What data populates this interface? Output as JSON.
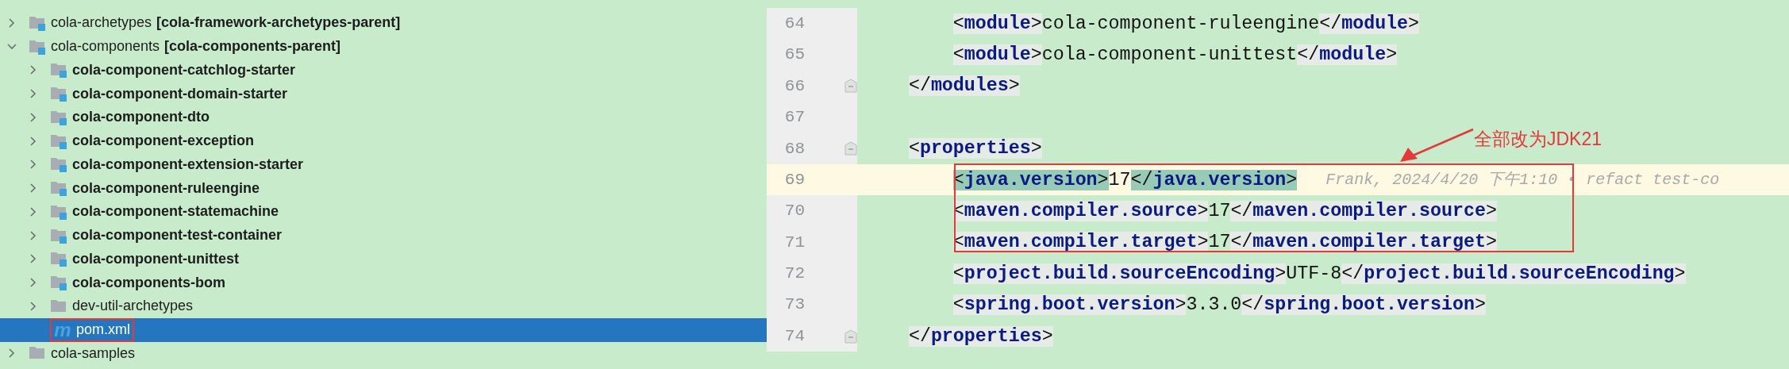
{
  "tree": [
    {
      "name": "cola-archetypes",
      "module": "[cola-framework-archetypes-parent]",
      "kind": "module",
      "bold": false,
      "expanded": false,
      "selected": false,
      "boxed": false
    },
    {
      "name": "cola-components",
      "module": "[cola-components-parent]",
      "kind": "module",
      "bold": false,
      "expanded": true,
      "selected": false,
      "boxed": false,
      "children": [
        {
          "name": "cola-component-catchlog-starter",
          "kind": "module",
          "bold": true,
          "expanded": false,
          "selected": false,
          "boxed": false
        },
        {
          "name": "cola-component-domain-starter",
          "kind": "module",
          "bold": true,
          "expanded": false,
          "selected": false,
          "boxed": false
        },
        {
          "name": "cola-component-dto",
          "kind": "module",
          "bold": true,
          "expanded": false,
          "selected": false,
          "boxed": false
        },
        {
          "name": "cola-component-exception",
          "kind": "module",
          "bold": true,
          "expanded": false,
          "selected": false,
          "boxed": false
        },
        {
          "name": "cola-component-extension-starter",
          "kind": "module",
          "bold": true,
          "expanded": false,
          "selected": false,
          "boxed": false
        },
        {
          "name": "cola-component-ruleengine",
          "kind": "module",
          "bold": true,
          "expanded": false,
          "selected": false,
          "boxed": false
        },
        {
          "name": "cola-component-statemachine",
          "kind": "module",
          "bold": true,
          "expanded": false,
          "selected": false,
          "boxed": false
        },
        {
          "name": "cola-component-test-container",
          "kind": "module",
          "bold": true,
          "expanded": false,
          "selected": false,
          "boxed": false
        },
        {
          "name": "cola-component-unittest",
          "kind": "module",
          "bold": true,
          "expanded": false,
          "selected": false,
          "boxed": false
        },
        {
          "name": "cola-components-bom",
          "kind": "module",
          "bold": true,
          "expanded": false,
          "selected": false,
          "boxed": false
        },
        {
          "name": "dev-util-archetypes",
          "kind": "folder",
          "bold": false,
          "expanded": false,
          "selected": false,
          "boxed": false
        },
        {
          "name": "pom.xml",
          "kind": "maven-file",
          "icon": "m",
          "bold": false,
          "selected": true,
          "boxed": true
        }
      ]
    },
    {
      "name": "cola-samples",
      "kind": "folder",
      "bold": false,
      "expanded": false,
      "selected": false,
      "boxed": false
    }
  ],
  "editor": {
    "lines": [
      {
        "number": "64",
        "current": false,
        "fold": false,
        "tokens": [
          {
            "kind": "tag",
            "text": "        <module>",
            "matched": false
          },
          {
            "kind": "text",
            "text": "cola-component-ruleengine"
          },
          {
            "kind": "tag",
            "text": "</module>",
            "matched": false
          }
        ]
      },
      {
        "number": "65",
        "current": false,
        "fold": false,
        "tokens": [
          {
            "kind": "tag",
            "text": "        <module>",
            "matched": false
          },
          {
            "kind": "text",
            "text": "cola-component-unittest"
          },
          {
            "kind": "tag",
            "text": "</module>",
            "matched": false
          }
        ]
      },
      {
        "number": "66",
        "current": false,
        "fold": true,
        "tokens": [
          {
            "kind": "tag",
            "text": "    </modules>",
            "matched": false
          }
        ]
      },
      {
        "number": "67",
        "current": false,
        "fold": false
      },
      {
        "number": "68",
        "current": false,
        "fold": true,
        "tokens": [
          {
            "kind": "tag",
            "text": "    <properties>",
            "matched": false
          }
        ]
      },
      {
        "number": "69",
        "current": true,
        "fold": false,
        "blame": "Frank, 2024/4/20 下午1:10 • refact test-co",
        "tokens": [
          {
            "kind": "tag",
            "text": "        <java.version>",
            "matched": true
          },
          {
            "kind": "text",
            "text": "17"
          },
          {
            "kind": "tag",
            "text": "</java.version>",
            "matched": true
          }
        ]
      },
      {
        "number": "70",
        "current": false,
        "fold": false,
        "tokens": [
          {
            "kind": "tag",
            "text": "        <maven.compiler.source>",
            "matched": false
          },
          {
            "kind": "text",
            "text": "17"
          },
          {
            "kind": "tag",
            "text": "</maven.compiler.source>",
            "matched": false
          }
        ]
      },
      {
        "number": "71",
        "current": false,
        "fold": false,
        "tokens": [
          {
            "kind": "tag",
            "text": "        <maven.compiler.target>",
            "matched": false
          },
          {
            "kind": "text",
            "text": "17"
          },
          {
            "kind": "tag",
            "text": "</maven.compiler.target>",
            "matched": false
          }
        ]
      },
      {
        "number": "72",
        "current": false,
        "fold": false,
        "tokens": [
          {
            "kind": "tag",
            "text": "        <project.build.sourceEncoding>",
            "matched": false
          },
          {
            "kind": "text",
            "text": "UTF-8"
          },
          {
            "kind": "tag",
            "text": "</project.build.sourceEncoding>",
            "matched": false
          }
        ]
      },
      {
        "number": "73",
        "current": false,
        "fold": false,
        "tokens": [
          {
            "kind": "tag",
            "text": "        <spring.boot.version>",
            "matched": false
          },
          {
            "kind": "text",
            "text": "3.3.0"
          },
          {
            "kind": "tag",
            "text": "</spring.boot.version>",
            "matched": false
          }
        ]
      },
      {
        "number": "74",
        "current": false,
        "fold": true,
        "tokens": [
          {
            "kind": "tag",
            "text": "    </properties>",
            "matched": false
          }
        ]
      }
    ]
  },
  "annotation": {
    "label": "全部改为JDK21"
  }
}
